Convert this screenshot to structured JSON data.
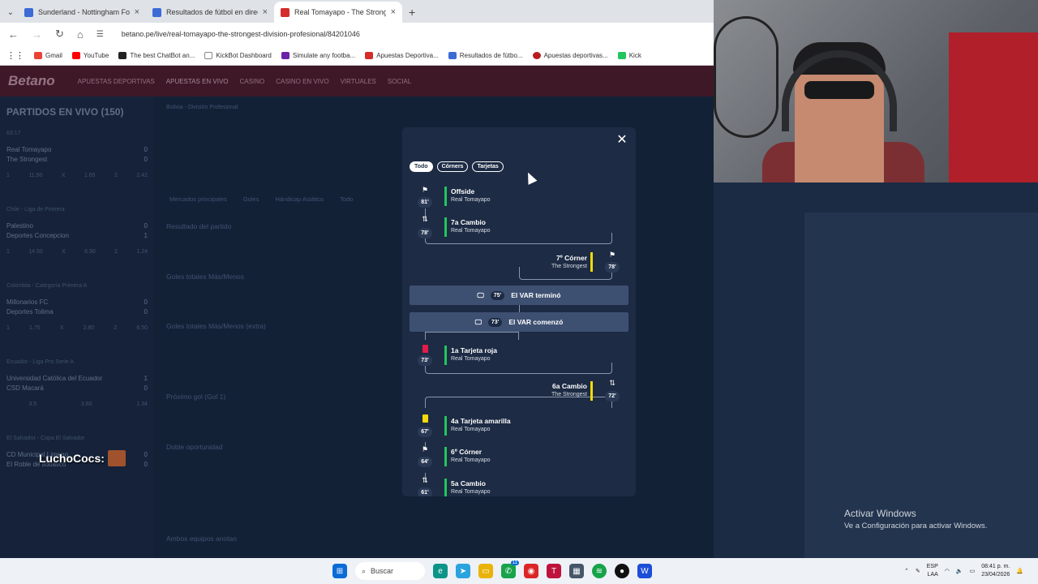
{
  "browser": {
    "tabs": [
      {
        "title": "Sunderland - Nottingham Fore…",
        "fav": "blue"
      },
      {
        "title": "Resultados de fútbol en directo",
        "fav": "blue"
      },
      {
        "title": "Real Tomayapo - The Stronges…",
        "fav": "betano",
        "active": true
      }
    ],
    "url": "betano.pe/live/real-tomayapo-the-strongest-division-profesional/84201046",
    "bookmarks": [
      "Gmail",
      "YouTube",
      "The best ChatBot an...",
      "KickBot Dashboard",
      "Simulate any footba...",
      "Apuestas Deportiva...",
      "Resultados de fútbo...",
      "Apuestas deportivas...",
      "Kick"
    ]
  },
  "site": {
    "logo": "Betano",
    "nav": [
      "APUESTAS DEPORTIVAS",
      "APUESTAS EN VIVO",
      "CASINO",
      "CASINO EN VIVO",
      "VIRTUALES",
      "SOCIAL"
    ],
    "breadcrumb": "Bolivia - División Profesional",
    "sidebar_title": "PARTIDOS EN VIVO (150)",
    "matches": [
      {
        "league": "63:17",
        "home": "Real Tomayapo",
        "away": "The Strongest",
        "hs": "0",
        "as": "0",
        "o1": "11.50",
        "ox": "1.65",
        "o2": "2.42"
      },
      {
        "league": "Chile - Liga de Primera",
        "home": "Palestino",
        "away": "Deportes Concepcion",
        "hs": "0",
        "as": "1",
        "o1": "14.50",
        "ox": "6.90",
        "o2": "1.24"
      },
      {
        "league": "Colombia - Categoría Primera A",
        "home": "Millonarios FC",
        "away": "Deportes Tolima",
        "hs": "0",
        "as": "0",
        "o1": "1.75",
        "ox": "2.80",
        "o2": "6.50"
      },
      {
        "league": "Ecuador - Liga Pro Serie A",
        "home": "Universidad Católica del Ecuador",
        "away": "CSD Macará",
        "hs": "1",
        "as": "0",
        "o1": "3.5",
        "ox": "3.60",
        "o2": "1.34"
      },
      {
        "league": "El Salvador - Copa El Salvador",
        "home": "CD Municipal Limeno",
        "away": "El Roble de Ilobasco",
        "hs": "0",
        "as": "0",
        "o1": "",
        "ox": "",
        "o2": ""
      }
    ],
    "markets": [
      "Mercados principales",
      "Goles",
      "Hándicap Asiático",
      "Todo"
    ],
    "sections": [
      "Resultado del partido",
      "Goles totales Más/Menos",
      "Goles totales Más/Menos (extra)",
      "Próximo gol (Gol 1)",
      "Doble oportunidad",
      "Ambos equipos anotan"
    ]
  },
  "modal": {
    "filters": [
      "Todo",
      "Córners",
      "Tarjetas"
    ],
    "events": [
      {
        "title": "Offside",
        "team": "Real Tomayapo",
        "minute": "81'",
        "side": "left",
        "icon": "flag-icon",
        "color": "#22c55e"
      },
      {
        "title": "7a Cambio",
        "team": "Real Tomayapo",
        "minute": "78'",
        "side": "left",
        "icon": "swap-icon",
        "color": "#22c55e"
      },
      {
        "title": "7º Córner",
        "team": "The Strongest",
        "minute": "78'",
        "side": "right",
        "icon": "corner-flag-icon",
        "color": "#f5d90a"
      },
      {
        "title": "1a Tarjeta roja",
        "team": "Real Tomayapo",
        "minute": "73'",
        "side": "left",
        "icon": "red-card-icon",
        "color": "#22c55e"
      },
      {
        "title": "6a Cambio",
        "team": "The Strongest",
        "minute": "72'",
        "side": "right",
        "icon": "swap-icon",
        "color": "#f5d90a"
      },
      {
        "title": "4a Tarjeta amarilla",
        "team": "Real Tomayapo",
        "minute": "67'",
        "side": "left",
        "icon": "yellow-card-icon",
        "color": "#22c55e"
      },
      {
        "title": "6º Córner",
        "team": "Real Tomayapo",
        "minute": "64'",
        "side": "left",
        "icon": "corner-flag-icon",
        "color": "#22c55e"
      },
      {
        "title": "5a Cambio",
        "team": "Real Tomayapo",
        "minute": "61'",
        "side": "left",
        "icon": "swap-icon",
        "color": "#22c55e"
      }
    ],
    "var": [
      {
        "minute": "75'",
        "label": "El VAR terminó"
      },
      {
        "minute": "73'",
        "label": "El VAR comenzó"
      }
    ]
  },
  "overlay": {
    "streamer": "LuchoCocs:",
    "activar_title": "Activar Windows",
    "activar_sub": "Ve a Configuración para activar Windows."
  },
  "taskbar": {
    "search": "Buscar",
    "lang": "ESP",
    "lang2": "LAA",
    "time": "08:41 p. m.",
    "date": "23/04/2026",
    "badge": "11"
  }
}
